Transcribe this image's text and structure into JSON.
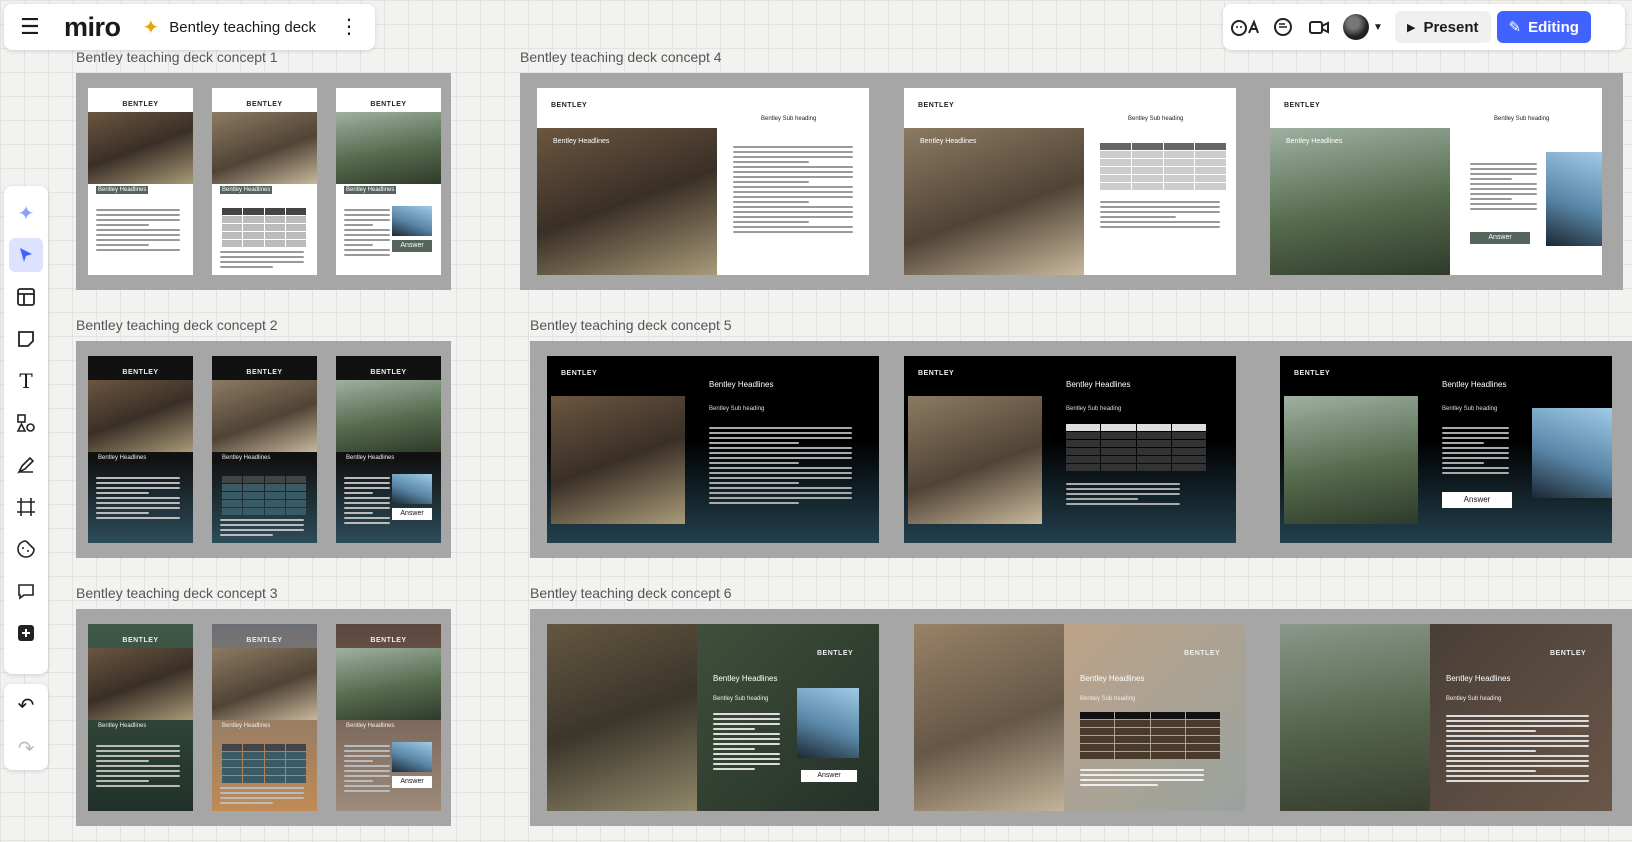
{
  "app": {
    "logo": "miro",
    "board_name": "Bentley teaching deck"
  },
  "toolbar": {
    "present_label": "Present",
    "editing_label": "Editing"
  },
  "frames": [
    {
      "label": "Bentley teaching deck concept 1"
    },
    {
      "label": "Bentley teaching deck concept 2"
    },
    {
      "label": "Bentley teaching deck concept 3"
    },
    {
      "label": "Bentley teaching deck concept 4"
    },
    {
      "label": "Bentley teaching deck concept 5"
    },
    {
      "label": "Bentley teaching deck concept 6"
    }
  ],
  "slide_text": {
    "brand": "BENTLEY",
    "headline": "Bentley Headlines",
    "subheading": "Bentley Sub heading",
    "answer": "Answer"
  },
  "left_tools": [
    "sparkle-icon",
    "select-cursor-icon",
    "templates-icon",
    "sticky-note-icon",
    "text-icon",
    "shapes-icon",
    "pen-icon",
    "frame-icon",
    "stickers-icon",
    "comment-icon",
    "add-icon"
  ],
  "colors": {
    "accent": "#4262ff",
    "frame_bg": "#a6a6a6",
    "sparkle": "#e8a20c"
  }
}
